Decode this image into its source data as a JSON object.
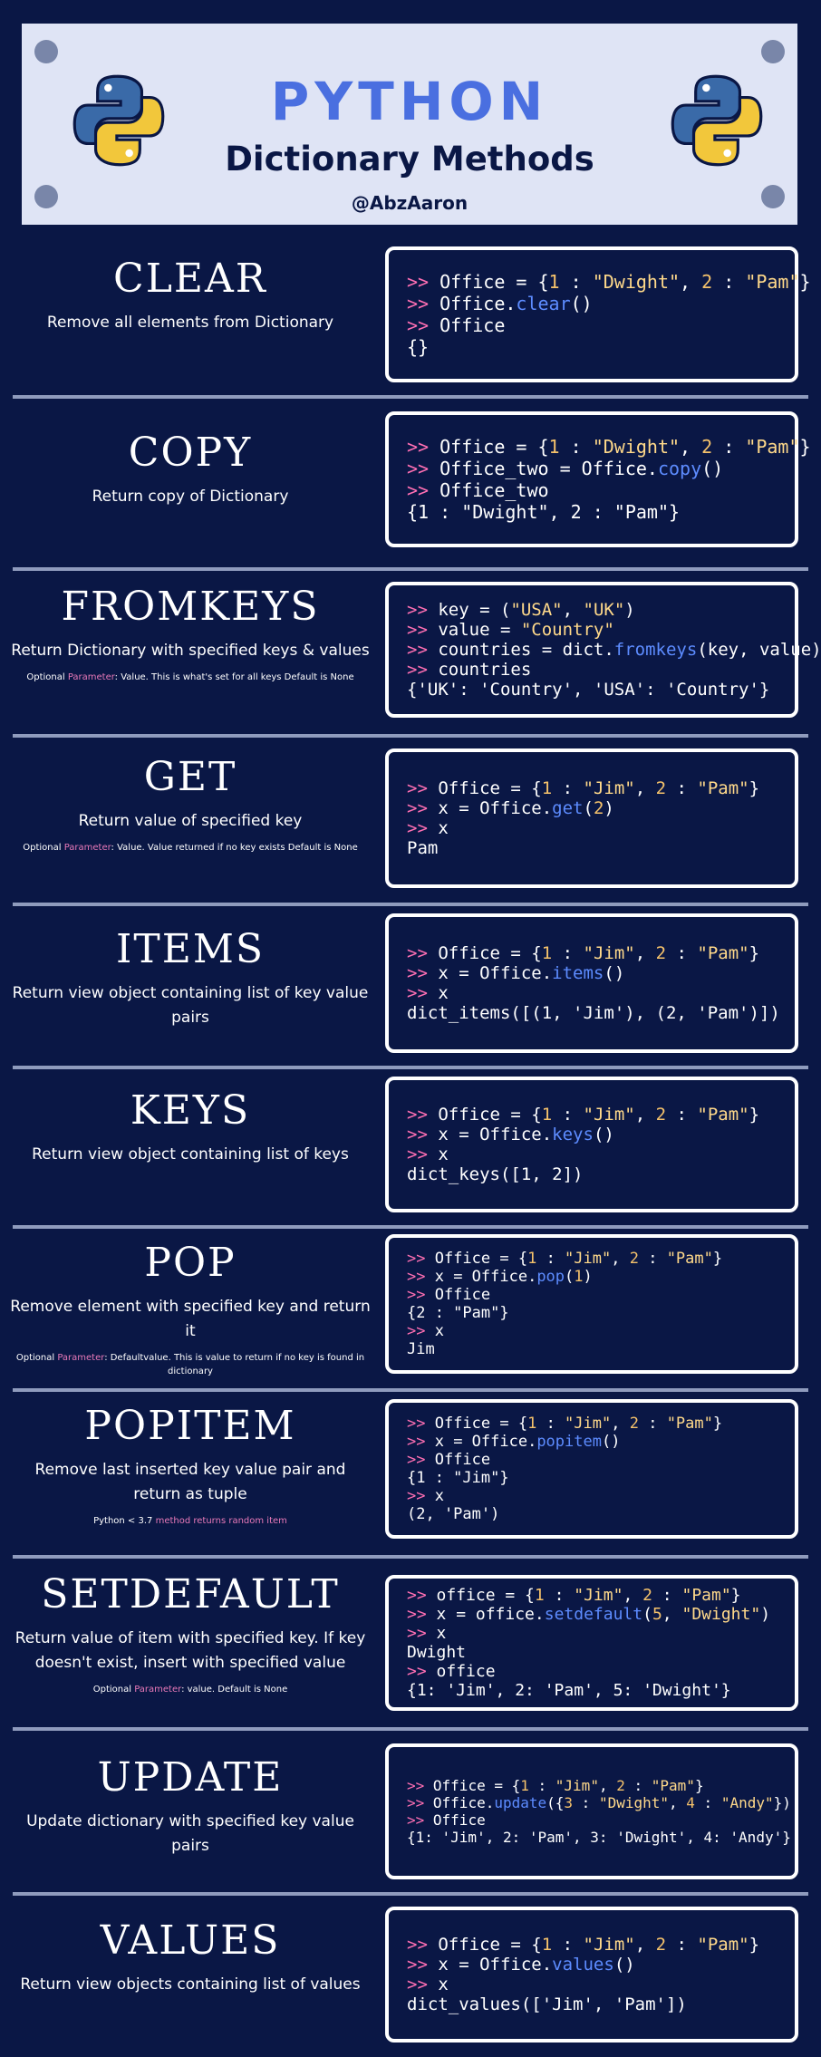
{
  "header": {
    "title": "PYTHON",
    "subtitle": "Dictionary Methods",
    "handle": "@AbzAaron"
  },
  "colors": {
    "background": "#0a1745",
    "header_bg": "#dfe4f5",
    "title_blue": "#4a6fe0",
    "prompt_pink": "#ff6fb3",
    "string_yellow": "#ffd98a",
    "method_blue": "#5d8cff",
    "python_blue": "#3a6aa8",
    "python_yellow": "#f2c73b"
  },
  "sections": [
    {
      "name": "CLEAR",
      "description": "Remove all elements from Dictionary",
      "code": [
        [
          [
            "p",
            ">> "
          ],
          [
            "t",
            "Office = {"
          ],
          [
            "n",
            "1"
          ],
          [
            "t",
            " : "
          ],
          [
            "s",
            "\"Dwight\""
          ],
          [
            "t",
            ", "
          ],
          [
            "n",
            "2"
          ],
          [
            "t",
            " : "
          ],
          [
            "s",
            "\"Pam\""
          ],
          [
            "t",
            "}"
          ]
        ],
        [
          [
            "p",
            ">> "
          ],
          [
            "t",
            "Office."
          ],
          [
            "m",
            "clear"
          ],
          [
            "t",
            "()"
          ]
        ],
        [
          [
            "p",
            ">> "
          ],
          [
            "t",
            "Office"
          ]
        ],
        [
          [
            "t",
            "{}"
          ]
        ]
      ]
    },
    {
      "name": "COPY",
      "description": "Return copy of Dictionary",
      "code": [
        [
          [
            "p",
            ">> "
          ],
          [
            "t",
            "Office = {"
          ],
          [
            "n",
            "1"
          ],
          [
            "t",
            " : "
          ],
          [
            "s",
            "\"Dwight\""
          ],
          [
            "t",
            ", "
          ],
          [
            "n",
            "2"
          ],
          [
            "t",
            " : "
          ],
          [
            "s",
            "\"Pam\""
          ],
          [
            "t",
            "}"
          ]
        ],
        [
          [
            "p",
            ">> "
          ],
          [
            "t",
            "Office_two = Office."
          ],
          [
            "m",
            "copy"
          ],
          [
            "t",
            "()"
          ]
        ],
        [
          [
            "p",
            ">> "
          ],
          [
            "t",
            "Office_two"
          ]
        ],
        [
          [
            "t",
            "{1 : \"Dwight\", 2 : \"Pam\"}"
          ]
        ]
      ]
    },
    {
      "name": "FROMKEYS",
      "description": "Return Dictionary with specified keys & values",
      "note_prefix": "Optional ",
      "note_highlight": "Parameter",
      "note_rest": ": Value. This is what's set for all keys Default is None",
      "code": [
        [
          [
            "p",
            ">> "
          ],
          [
            "t",
            "key = ("
          ],
          [
            "s",
            "\"USA\""
          ],
          [
            "t",
            ", "
          ],
          [
            "s",
            "\"UK\""
          ],
          [
            "t",
            ")"
          ]
        ],
        [
          [
            "p",
            ">> "
          ],
          [
            "t",
            "value = "
          ],
          [
            "s",
            "\"Country\""
          ]
        ],
        [
          [
            "p",
            ">> "
          ],
          [
            "t",
            "countries = dict."
          ],
          [
            "m",
            "fromkeys"
          ],
          [
            "t",
            "(key, value)"
          ]
        ],
        [
          [
            "p",
            ">> "
          ],
          [
            "t",
            "countries"
          ]
        ],
        [
          [
            "t",
            "{'UK': 'Country', 'USA': 'Country'}"
          ]
        ]
      ]
    },
    {
      "name": "GET",
      "description": "Return value of specified key",
      "note_prefix": "Optional ",
      "note_highlight": "Parameter",
      "note_rest": ": Value. Value returned if no key exists Default is None",
      "code": [
        [
          [
            "p",
            ">> "
          ],
          [
            "t",
            "Office = {"
          ],
          [
            "n",
            "1"
          ],
          [
            "t",
            " : "
          ],
          [
            "s",
            "\"Jim\""
          ],
          [
            "t",
            ", "
          ],
          [
            "n",
            "2"
          ],
          [
            "t",
            " : "
          ],
          [
            "s",
            "\"Pam\""
          ],
          [
            "t",
            "}"
          ]
        ],
        [
          [
            "p",
            ">> "
          ],
          [
            "t",
            "x = Office."
          ],
          [
            "m",
            "get"
          ],
          [
            "t",
            "("
          ],
          [
            "n",
            "2"
          ],
          [
            "t",
            ")"
          ]
        ],
        [
          [
            "p",
            ">> "
          ],
          [
            "t",
            "x"
          ]
        ],
        [
          [
            "t",
            "Pam"
          ]
        ]
      ]
    },
    {
      "name": "ITEMS",
      "description": "Return view object containing list of key value pairs",
      "code": [
        [
          [
            "p",
            ">> "
          ],
          [
            "t",
            "Office = {"
          ],
          [
            "n",
            "1"
          ],
          [
            "t",
            " : "
          ],
          [
            "s",
            "\"Jim\""
          ],
          [
            "t",
            ", "
          ],
          [
            "n",
            "2"
          ],
          [
            "t",
            " : "
          ],
          [
            "s",
            "\"Pam\""
          ],
          [
            "t",
            "}"
          ]
        ],
        [
          [
            "p",
            ">> "
          ],
          [
            "t",
            "x = Office."
          ],
          [
            "m",
            "items"
          ],
          [
            "t",
            "()"
          ]
        ],
        [
          [
            "p",
            ">> "
          ],
          [
            "t",
            "x"
          ]
        ],
        [
          [
            "t",
            "dict_items([(1, 'Jim'), (2, 'Pam')])"
          ]
        ]
      ]
    },
    {
      "name": "KEYS",
      "description": "Return view object containing list of keys",
      "code": [
        [
          [
            "p",
            ">> "
          ],
          [
            "t",
            "Office = {"
          ],
          [
            "n",
            "1"
          ],
          [
            "t",
            " : "
          ],
          [
            "s",
            "\"Jim\""
          ],
          [
            "t",
            ", "
          ],
          [
            "n",
            "2"
          ],
          [
            "t",
            " : "
          ],
          [
            "s",
            "\"Pam\""
          ],
          [
            "t",
            "}"
          ]
        ],
        [
          [
            "p",
            ">> "
          ],
          [
            "t",
            "x = Office."
          ],
          [
            "m",
            "keys"
          ],
          [
            "t",
            "()"
          ]
        ],
        [
          [
            "p",
            ">> "
          ],
          [
            "t",
            "x"
          ]
        ],
        [
          [
            "t",
            "dict_keys([1, 2])"
          ]
        ]
      ]
    },
    {
      "name": "POP",
      "description": "Remove element with specified key and return it",
      "note_prefix": "Optional ",
      "note_highlight": "Parameter",
      "note_rest": ": Defaultvalue. This is value to return if no key is found in dictionary",
      "code": [
        [
          [
            "p",
            ">> "
          ],
          [
            "t",
            "Office = {"
          ],
          [
            "n",
            "1"
          ],
          [
            "t",
            " : "
          ],
          [
            "s",
            "\"Jim\""
          ],
          [
            "t",
            ", "
          ],
          [
            "n",
            "2"
          ],
          [
            "t",
            " : "
          ],
          [
            "s",
            "\"Pam\""
          ],
          [
            "t",
            "}"
          ]
        ],
        [
          [
            "p",
            ">> "
          ],
          [
            "t",
            "x = Office."
          ],
          [
            "m",
            "pop"
          ],
          [
            "t",
            "("
          ],
          [
            "n",
            "1"
          ],
          [
            "t",
            ")"
          ]
        ],
        [
          [
            "p",
            ">> "
          ],
          [
            "t",
            "Office"
          ]
        ],
        [
          [
            "t",
            "{2 : \"Pam\"}"
          ]
        ],
        [
          [
            "p",
            ">> "
          ],
          [
            "t",
            "x"
          ]
        ],
        [
          [
            "t",
            "Jim"
          ]
        ]
      ]
    },
    {
      "name": "POPITEM",
      "description": "Remove last inserted key value pair and return as tuple",
      "note_prefix": "Python < 3.7 ",
      "note_highlight": "method returns random item",
      "note_rest": "",
      "code": [
        [
          [
            "p",
            ">> "
          ],
          [
            "t",
            "Office = {"
          ],
          [
            "n",
            "1"
          ],
          [
            "t",
            " : "
          ],
          [
            "s",
            "\"Jim\""
          ],
          [
            "t",
            ", "
          ],
          [
            "n",
            "2"
          ],
          [
            "t",
            " : "
          ],
          [
            "s",
            "\"Pam\""
          ],
          [
            "t",
            "}"
          ]
        ],
        [
          [
            "p",
            ">> "
          ],
          [
            "t",
            "x = Office."
          ],
          [
            "m",
            "popitem"
          ],
          [
            "t",
            "()"
          ]
        ],
        [
          [
            "p",
            ">> "
          ],
          [
            "t",
            "Office"
          ]
        ],
        [
          [
            "t",
            "{1 : \"Jim\"}"
          ]
        ],
        [
          [
            "p",
            ">> "
          ],
          [
            "t",
            "x"
          ]
        ],
        [
          [
            "t",
            "(2, 'Pam')"
          ]
        ]
      ]
    },
    {
      "name": "SETDEFAULT",
      "description": "Return value of item with specified key. If key doesn't exist, insert with specified value",
      "note_prefix": "Optional ",
      "note_highlight": "Parameter",
      "note_rest": ": value. Default is None",
      "code": [
        [
          [
            "p",
            ">> "
          ],
          [
            "t",
            "office = {"
          ],
          [
            "n",
            "1"
          ],
          [
            "t",
            " : "
          ],
          [
            "s",
            "\"Jim\""
          ],
          [
            "t",
            ", "
          ],
          [
            "n",
            "2"
          ],
          [
            "t",
            " : "
          ],
          [
            "s",
            "\"Pam\""
          ],
          [
            "t",
            "}"
          ]
        ],
        [
          [
            "p",
            ">> "
          ],
          [
            "t",
            "x = office."
          ],
          [
            "m",
            "setdefault"
          ],
          [
            "t",
            "("
          ],
          [
            "n",
            "5"
          ],
          [
            "t",
            ", "
          ],
          [
            "s",
            "\"Dwight\""
          ],
          [
            "t",
            ")"
          ]
        ],
        [
          [
            "p",
            ">> "
          ],
          [
            "t",
            "x"
          ]
        ],
        [
          [
            "t",
            "Dwight"
          ]
        ],
        [
          [
            "p",
            ">> "
          ],
          [
            "t",
            "office"
          ]
        ],
        [
          [
            "t",
            "{1: 'Jim', 2: 'Pam', 5: 'Dwight'}"
          ]
        ]
      ]
    },
    {
      "name": "UPDATE",
      "description": "Update dictionary with specified key value pairs",
      "code": [
        [
          [
            "p",
            ">> "
          ],
          [
            "t",
            "Office = {"
          ],
          [
            "n",
            "1"
          ],
          [
            "t",
            " : "
          ],
          [
            "s",
            "\"Jim\""
          ],
          [
            "t",
            ", "
          ],
          [
            "n",
            "2"
          ],
          [
            "t",
            " : "
          ],
          [
            "s",
            "\"Pam\""
          ],
          [
            "t",
            "}"
          ]
        ],
        [
          [
            "p",
            ">> "
          ],
          [
            "t",
            "Office."
          ],
          [
            "m",
            "update"
          ],
          [
            "t",
            "({"
          ],
          [
            "n",
            "3"
          ],
          [
            "t",
            " : "
          ],
          [
            "s",
            "\"Dwight\""
          ],
          [
            "t",
            ", "
          ],
          [
            "n",
            "4"
          ],
          [
            "t",
            " : "
          ],
          [
            "s",
            "\"Andy\""
          ],
          [
            "t",
            "})"
          ]
        ],
        [
          [
            "p",
            ">> "
          ],
          [
            "t",
            "Office"
          ]
        ],
        [
          [
            "t",
            "{1: 'Jim', 2: 'Pam', 3: 'Dwight', 4: 'Andy'}"
          ]
        ]
      ]
    },
    {
      "name": "VALUES",
      "description": "Return view objects containing list of values",
      "code": [
        [
          [
            "p",
            ">> "
          ],
          [
            "t",
            "Office = {"
          ],
          [
            "n",
            "1"
          ],
          [
            "t",
            " : "
          ],
          [
            "s",
            "\"Jim\""
          ],
          [
            "t",
            ", "
          ],
          [
            "n",
            "2"
          ],
          [
            "t",
            " : "
          ],
          [
            "s",
            "\"Pam\""
          ],
          [
            "t",
            "}"
          ]
        ],
        [
          [
            "p",
            ">> "
          ],
          [
            "t",
            "x = Office."
          ],
          [
            "m",
            "values"
          ],
          [
            "t",
            "()"
          ]
        ],
        [
          [
            "p",
            ">> "
          ],
          [
            "t",
            "x"
          ]
        ],
        [
          [
            "t",
            "dict_values(['Jim', 'Pam'])"
          ]
        ]
      ]
    }
  ]
}
